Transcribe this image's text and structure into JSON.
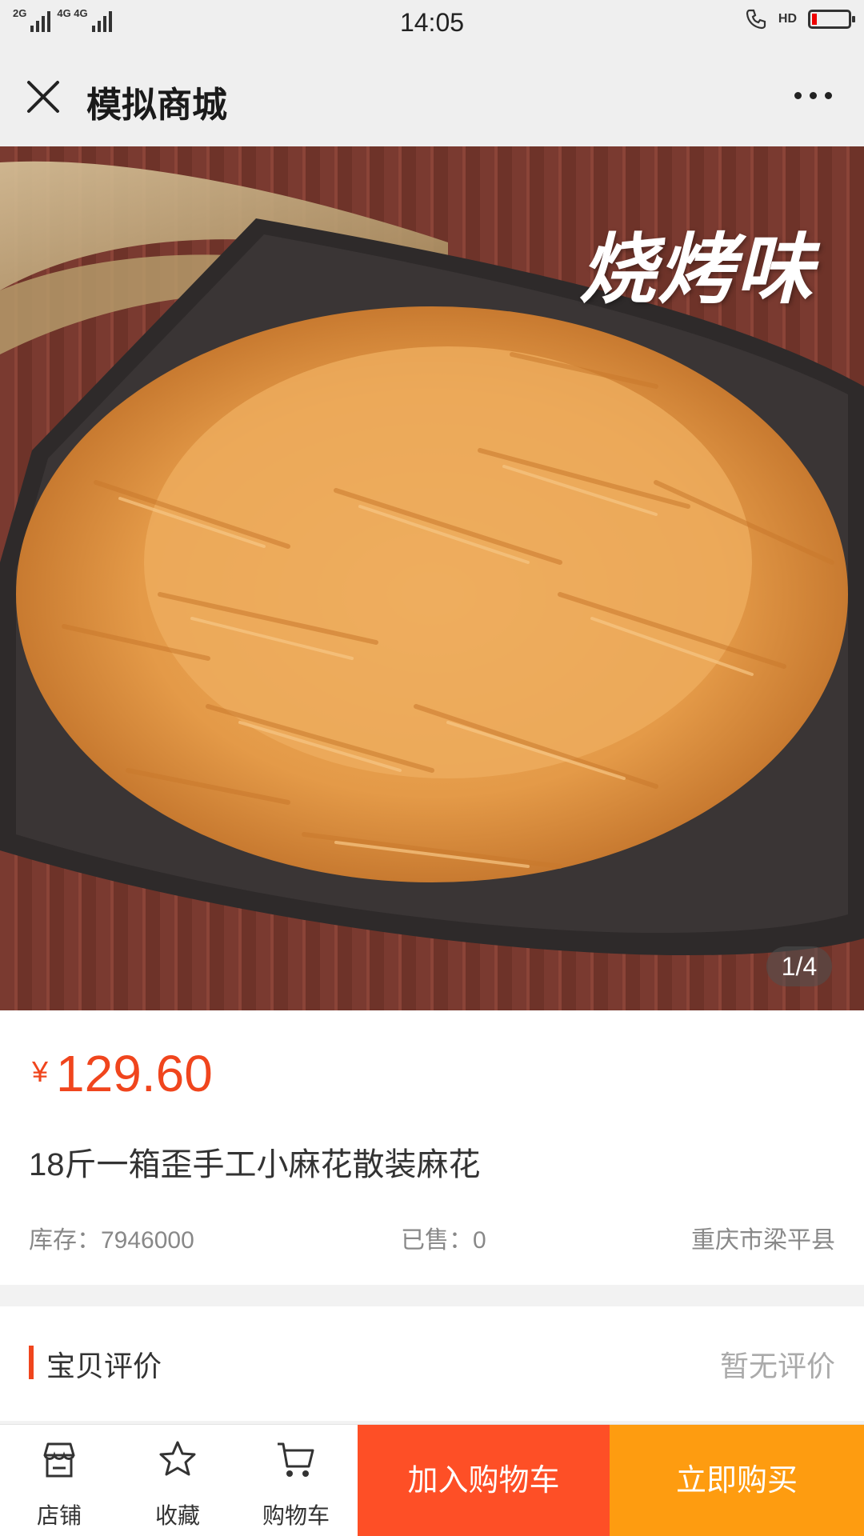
{
  "status_bar": {
    "net_left": "2G",
    "net_right": "4G 4G",
    "time": "14:05",
    "hd": "HD",
    "battery_level": 0.12,
    "battery_color": "#e00000"
  },
  "nav": {
    "title": "模拟商城",
    "close_icon": "close-icon",
    "more_icon": "more-icon"
  },
  "hero": {
    "caption": "烧烤味",
    "counter": "1/4"
  },
  "product": {
    "currency": "¥",
    "price": "129.60",
    "title": "18斤一箱歪手工小麻花散装麻花",
    "stock": "库存：7946000",
    "sold": "已售：0",
    "location": "重庆市梁平县"
  },
  "reviews": {
    "title": "宝贝评价",
    "empty": "暂无评价"
  },
  "bottom_bar": {
    "shop": "店铺",
    "favorite": "收藏",
    "cart": "购物车",
    "add_to_cart": "加入购物车",
    "buy_now": "立即购买"
  },
  "colors": {
    "accent": "#f0451d",
    "cart_button": "#fe4f26",
    "buy_button": "#fe9c10"
  }
}
